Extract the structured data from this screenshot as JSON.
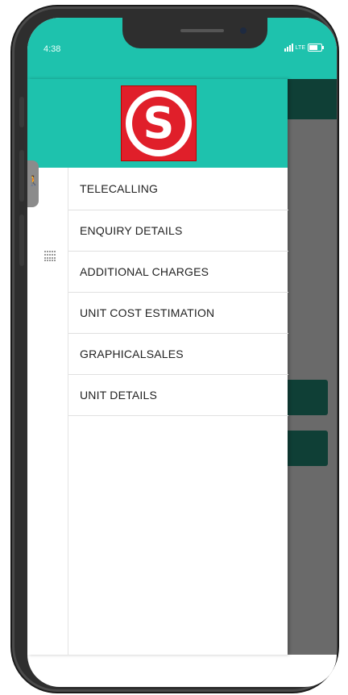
{
  "status_bar": {
    "time": "4:38",
    "network": "LTE"
  },
  "app": {
    "logo_letter": "S",
    "brand_color": "#e01f2a",
    "accent_color": "#1ec2ad"
  },
  "drawer": {
    "items": [
      {
        "label": "TELECALLING"
      },
      {
        "label": "ENQUIRY DETAILS"
      },
      {
        "label": "ADDITIONAL CHARGES"
      },
      {
        "label": "UNIT COST ESTIMATION"
      },
      {
        "label": "GRAPHICALSALES"
      },
      {
        "label": "UNIT DETAILS"
      }
    ]
  },
  "icons": {
    "accessibility": "accessibility-icon",
    "grid": "grid-dots-icon",
    "signal": "signal-icon",
    "battery": "battery-icon"
  }
}
